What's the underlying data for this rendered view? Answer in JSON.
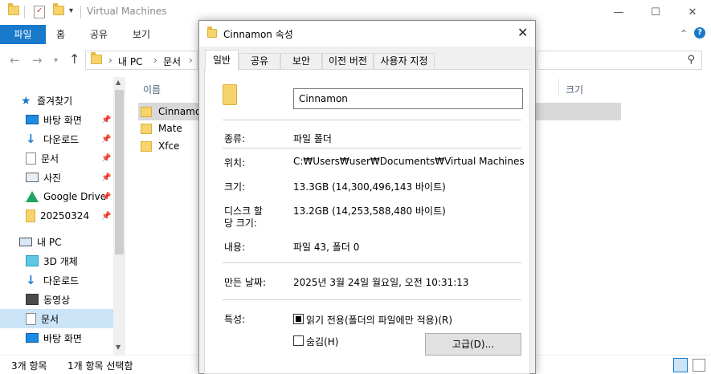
{
  "explorer": {
    "title": "Virtual Machines",
    "ribbon_tabs": [
      "파일",
      "홈",
      "공유",
      "보기"
    ],
    "breadcrumb": [
      "내 PC",
      "문서"
    ],
    "column_name": "이름",
    "column_size": "크기",
    "nav": {
      "quick_access": "즐겨찾기",
      "items": [
        {
          "label": "바탕 화면",
          "icon": "desktop-icon"
        },
        {
          "label": "다운로드",
          "icon": "download-icon"
        },
        {
          "label": "문서",
          "icon": "document-icon"
        },
        {
          "label": "사진",
          "icon": "picture-icon"
        },
        {
          "label": "Google Drive",
          "icon": "google-drive-icon"
        },
        {
          "label": "20250324",
          "icon": "folder-icon"
        }
      ],
      "this_pc": "내 PC",
      "pc_items": [
        {
          "label": "3D 개체",
          "icon": "3d-objects-icon"
        },
        {
          "label": "다운로드",
          "icon": "download-icon"
        },
        {
          "label": "동영상",
          "icon": "video-icon"
        },
        {
          "label": "문서",
          "icon": "document-icon"
        },
        {
          "label": "바탕 화면",
          "icon": "desktop-icon"
        }
      ]
    },
    "files": [
      "Cinnamon",
      "Mate",
      "Xfce"
    ],
    "status_count": "3개 항목",
    "status_selected": "1개 항목 선택함",
    "accent": "#1979ca"
  },
  "dialog": {
    "title": "Cinnamon 속성",
    "tabs": [
      "일반",
      "공유",
      "보안",
      "이전 버전",
      "사용자 지정"
    ],
    "name_value": "Cinnamon",
    "type_label": "종류:",
    "type_value": "파일 폴더",
    "location_label": "위치:",
    "location_value": "C:₩Users₩user₩Documents₩Virtual Machines",
    "size_label": "크기:",
    "size_value": "13.3GB (14,300,496,143 바이트)",
    "disk_label_1": "디스크 할",
    "disk_label_2": "당 크기:",
    "disk_value": "13.2GB (14,253,588,480 바이트)",
    "contents_label": "내용:",
    "contents_value": "파일 43, 폴더 0",
    "created_label": "만든 날짜:",
    "created_value": "2025년 3월 24일 월요일, 오전 10:31:13",
    "attributes_label": "특성:",
    "readonly_label": "읽기 전용(폴더의 파일에만 적용)(R)",
    "hidden_label": "숨김(H)",
    "advanced_label": "고급(D)..."
  }
}
